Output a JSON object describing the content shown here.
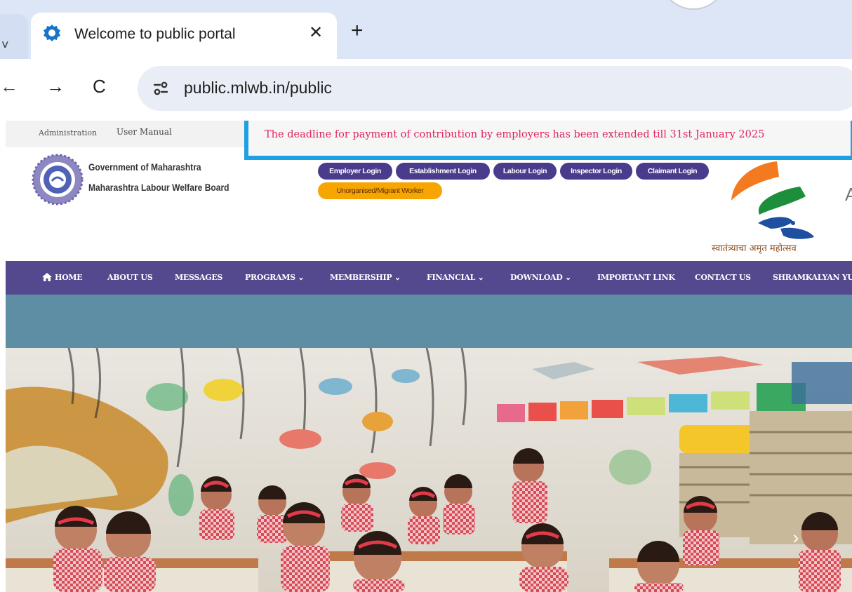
{
  "browser": {
    "tab_title": "Welcome to public portal",
    "tab_close": "✕",
    "new_tab": "+",
    "prev_tab_caret": "˅",
    "url": "public.mlwb.in/public",
    "icons": {
      "back": "←",
      "forward": "→",
      "reload": "C"
    }
  },
  "topbar": {
    "links": [
      "Administration",
      "User Manual"
    ]
  },
  "notice": {
    "text": "The deadline for payment of contribution by employers has been extended till 31st January 2025",
    "color": "#e0245a",
    "border_color": "#1ea0e3"
  },
  "header": {
    "org_line1": "Government of Maharashtra",
    "org_line2": "Maharashtra Labour Welfare Board",
    "logins": [
      "Employer Login",
      "Establishment Login",
      "Labour Login",
      "Inspector Login",
      "Claimant Login"
    ],
    "unorganised": "Unorganised/Migrant Worker",
    "azadi_tagline": "स्वातंत्र्याचा अमृत महोत्सव",
    "azadi_cut": "A"
  },
  "nav": {
    "home": "HOME",
    "about": "ABOUT US",
    "messages": "MESSAGES",
    "programs": "PROGRAMS ⌄",
    "membership": "MEMBERSHIP ⌄",
    "financial": "FINANCIAL ⌄",
    "download": "DOWNLOAD ⌄",
    "important": "IMPORTANT LINK",
    "contact": "CONTACT US",
    "shramkalyan": "SHRAMKALYAN YUG"
  },
  "hero": {
    "next_arrow": "›"
  },
  "colors": {
    "nav_bg": "#54498e",
    "pill_bg": "#4a3b8c",
    "pill_orange": "#f7a500",
    "teal_band": "#5e8ea3"
  }
}
